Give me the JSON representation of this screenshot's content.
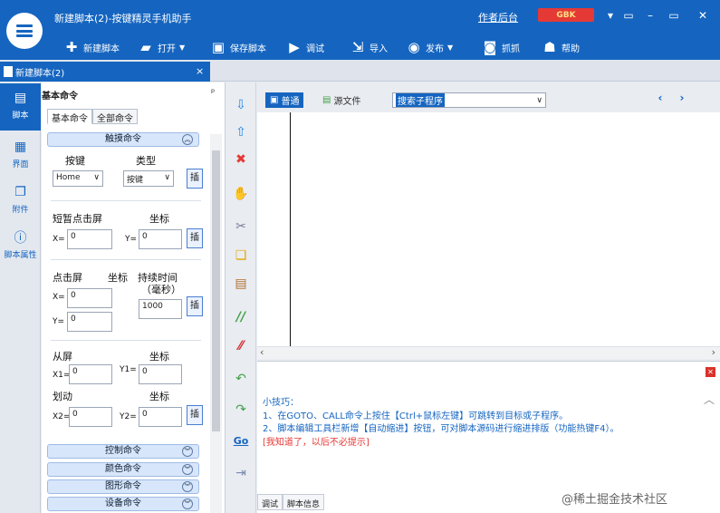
{
  "window": {
    "title": "新建脚本(2)-按键精灵手机助手",
    "author_link": "作者后台",
    "encoding": "GBK",
    "controls": [
      "▾",
      "▭",
      "–",
      "▭",
      "✕"
    ]
  },
  "toolbar": {
    "new_script": "新建脚本",
    "open": "打开",
    "save": "保存脚本",
    "debug": "调试",
    "import": "导入",
    "publish": "发布",
    "capture": "抓抓",
    "help": "帮助"
  },
  "doc_tab": {
    "label": "新建脚本(2)",
    "close": "×"
  },
  "leftnav": [
    {
      "label": "脚本",
      "icon": "script-icon"
    },
    {
      "label": "界面",
      "icon": "ui-icon"
    },
    {
      "label": "附件",
      "icon": "attachment-icon"
    },
    {
      "label": "脚本属性",
      "icon": "info-icon"
    }
  ],
  "panel": {
    "title": "基本命令",
    "pin": "ᵖ",
    "tabs": [
      "基本命令",
      "全部命令"
    ],
    "sections": {
      "touch": "触摸命令",
      "control": "控制命令",
      "color": "颜色命令",
      "graphics": "图形命令",
      "device": "设备命令"
    },
    "key_label": "按键",
    "type_label": "类型",
    "key_value": "Home",
    "type_value": "按键",
    "tap_label": "短暂点击屏",
    "coord_label": "坐标",
    "x_label": "X=",
    "y_label": "Y=",
    "x1_label": "X1=",
    "y1_label": "Y1=",
    "x2_label": "X2=",
    "y2_label": "Y2=",
    "zero": "0",
    "press_label": "点击屏",
    "duration_label": "持续时间",
    "duration_unit": "（毫秒）",
    "duration_value": "1000",
    "from_label": "从屏",
    "swipe_label": "划动",
    "insert_btn": "插"
  },
  "editor": {
    "tab_normal": "普通",
    "tab_source": "源文件",
    "sub_select": "搜索子程序",
    "prev": "‹",
    "next": "›"
  },
  "tips": {
    "title": "小技巧：",
    "line1": "1、在GOTO、CALL命令上按住【Ctrl+鼠标左键】可跳转到目标或子程序。",
    "line2": "2、脚本编辑工具栏新增【自动缩进】按钮，可对脚本源码进行缩进排版（功能热键F4）。",
    "dismiss": "[我知道了，以后不必提示]"
  },
  "bottom_tabs": [
    "调试",
    "脚本信息"
  ],
  "watermark": "@稀土掘金技术社区"
}
